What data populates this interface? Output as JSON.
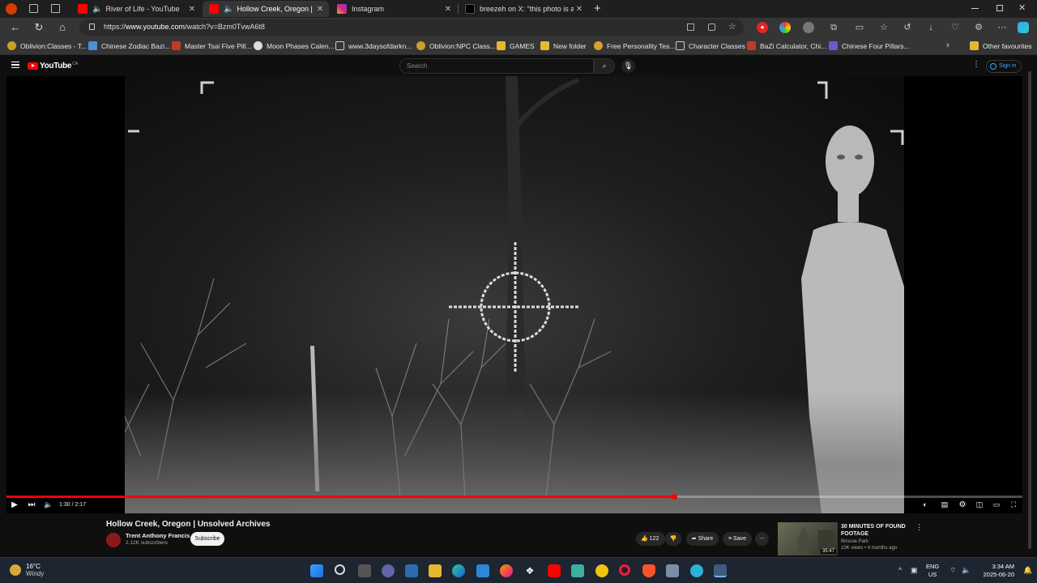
{
  "browser": {
    "tabs": [
      {
        "title": "River of Life - YouTube",
        "active": false,
        "audio": true
      },
      {
        "title": "Hollow Creek, Oregon | Unsolved Archives",
        "active": true,
        "audio": true
      },
      {
        "title": "Instagram",
        "active": false,
        "audio": false
      },
      {
        "title": "breezeh on X: \"this photo is actually",
        "active": false,
        "audio": false
      }
    ],
    "new_tab": "+",
    "url_prefix": "https://",
    "url_host": "www.youtube.com",
    "url_path": "/watch?v=Bzm0TvwA6t8",
    "bookmarks": [
      "Oblivion:Classes - T...",
      "Chinese Zodiac Bazi...",
      "Master Tsai Five Pill...",
      "Moon Phases Calen...",
      "www.3daysofdarkn...",
      "Oblivion:NPC Class...",
      "GAMES",
      "New folder",
      "Free Personality Tes...",
      "Character Classes",
      "BaZi Calculator, Chi...",
      "Chinese Four Pillars..."
    ],
    "other_favourites": "Other favourites"
  },
  "youtube": {
    "logo": "YouTube",
    "country": "CA",
    "search_placeholder": "Search",
    "sign_in": "Sign in",
    "player": {
      "current_time": "1:30",
      "duration": "2:17",
      "time_display": "1:30 / 2:17",
      "progress": 0.657
    },
    "video_title": "Hollow Creek, Oregon | Unsolved Archives",
    "channel_name": "Trent Anthony Francis",
    "subscribers": "2.12K subscribers",
    "subscribe": "Subscribe",
    "likes": "122",
    "share": "Share",
    "save": "Save",
    "recommended": {
      "title": "30 MINUTES OF FOUND FOOTAGE",
      "channel": "Briscoe Park",
      "meta": "10K views • 4 months ago",
      "duration": "35:47"
    }
  },
  "taskbar": {
    "temperature": "16°C",
    "condition": "Windy",
    "lang_1": "ENG",
    "lang_2": "US",
    "time": "3:34 AM",
    "date": "2025-06-20"
  },
  "colors": {
    "youtube_red": "#ff0000",
    "link_blue": "#3ea6ff"
  }
}
